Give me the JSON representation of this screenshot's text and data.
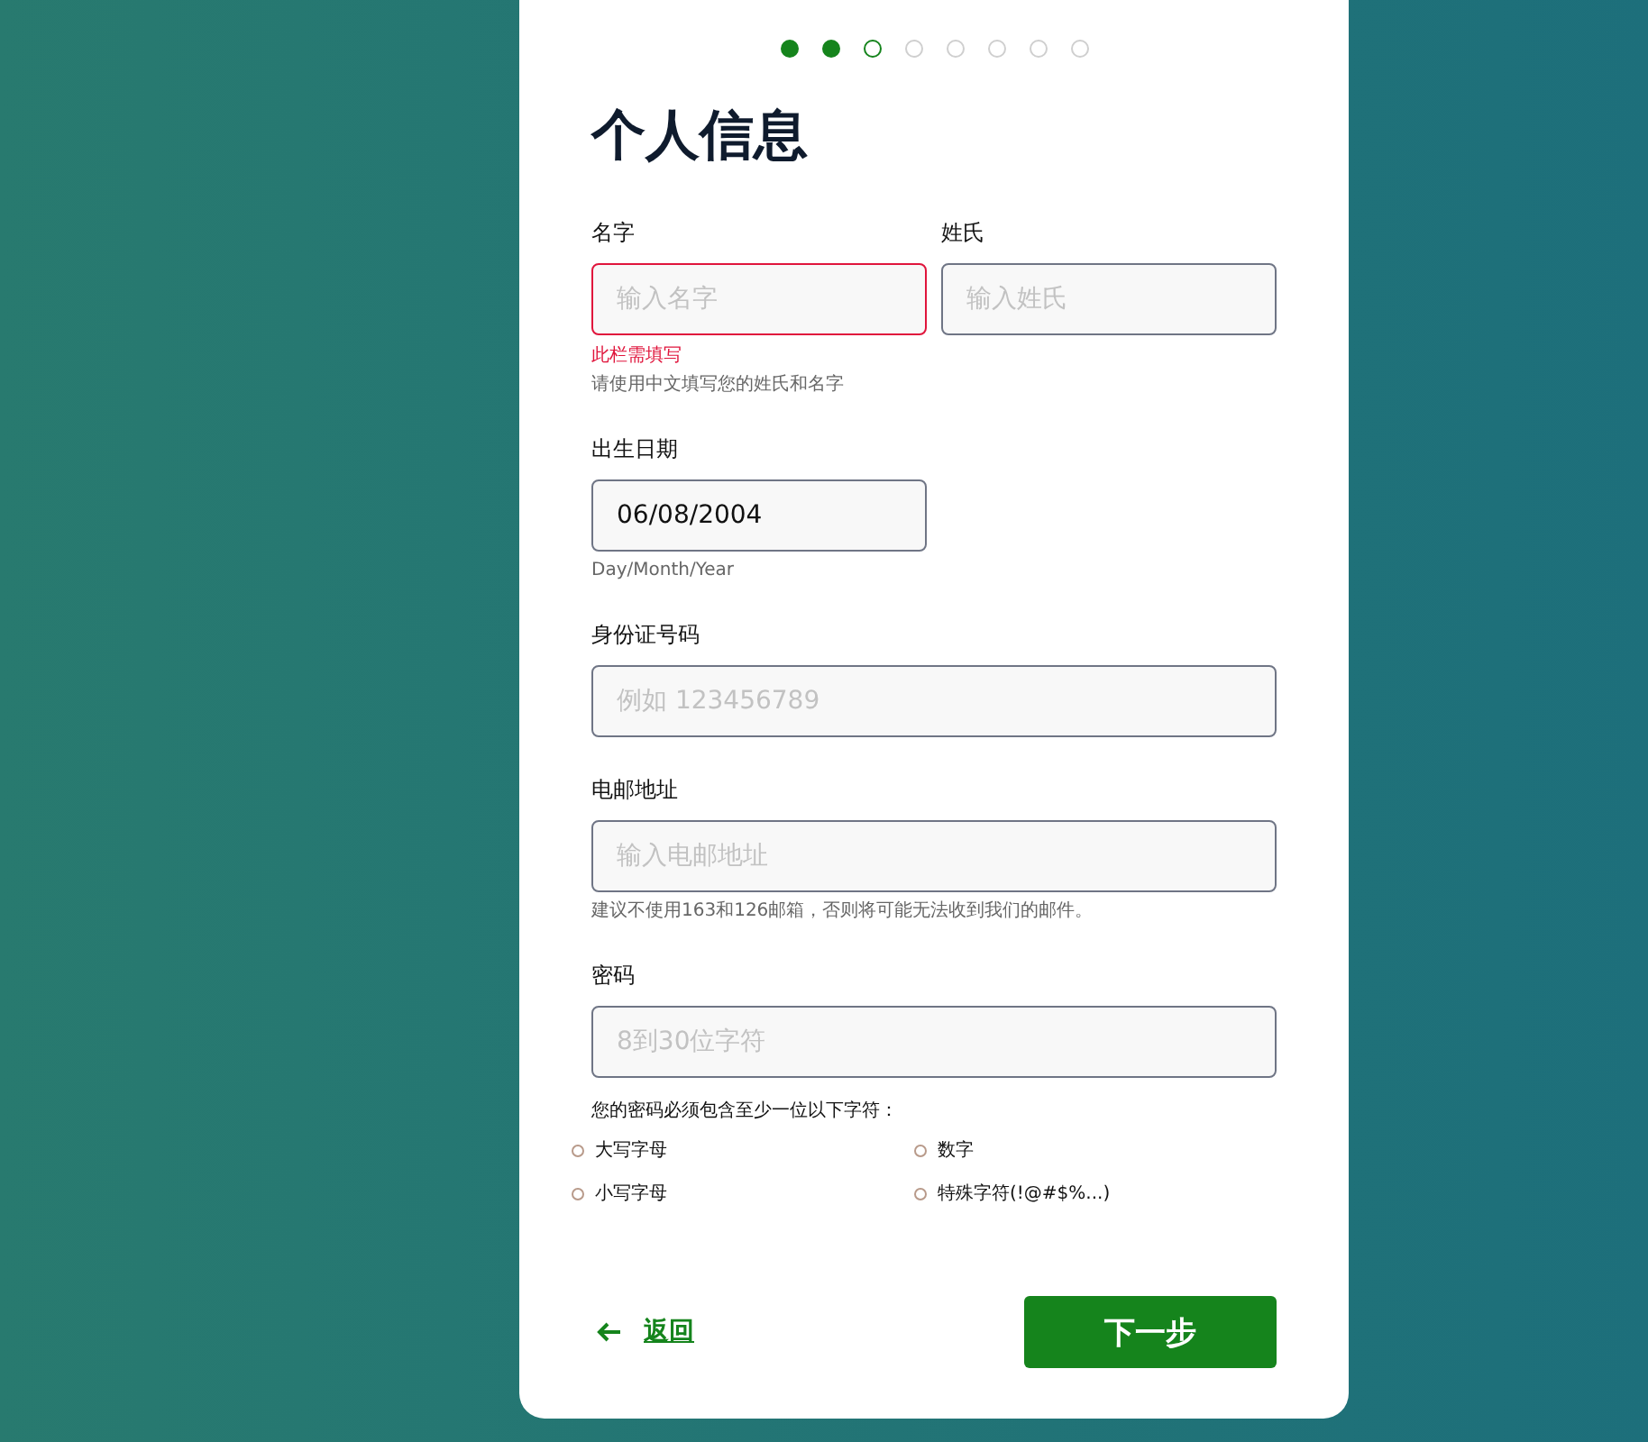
{
  "steps": [
    {
      "kind": "done"
    },
    {
      "kind": "done"
    },
    {
      "kind": "current"
    },
    {
      "kind": "pending"
    },
    {
      "kind": "pending"
    },
    {
      "kind": "pending"
    },
    {
      "kind": "pending"
    },
    {
      "kind": "pending"
    }
  ],
  "title": "个人信息",
  "name_fields": [
    {
      "label": "名字",
      "placeholder": "输入名字",
      "invalid": true
    },
    {
      "label": "姓氏",
      "placeholder": "输入姓氏",
      "invalid": false
    }
  ],
  "name_error": "此栏需填写",
  "name_hint": "请使用中文填写您的姓氏和名字",
  "fields": [
    {
      "kind": "date",
      "label": "出生日期",
      "value": "06/08/2004",
      "hint": "Day/Month/Year"
    },
    {
      "kind": "text",
      "label": "身份证号码",
      "placeholder": "例如 123456789"
    },
    {
      "kind": "text",
      "label": "电邮地址",
      "placeholder": "输入电邮地址",
      "hint": "建议不使用163和126邮箱，否则将可能无法收到我们的邮件。"
    },
    {
      "kind": "password",
      "label": "密码",
      "placeholder": "8到30位字符"
    }
  ],
  "password_rules_heading": "您的密码必须包含至少一位以下字符：",
  "password_rules": [
    {
      "text": "大写字母",
      "met": false
    },
    {
      "text": "数字",
      "met": false
    },
    {
      "text": "小写字母",
      "met": false
    },
    {
      "text": "特殊字符(!@#$%...)",
      "met": false
    }
  ],
  "back_link": "返回",
  "next_button": "下一步"
}
